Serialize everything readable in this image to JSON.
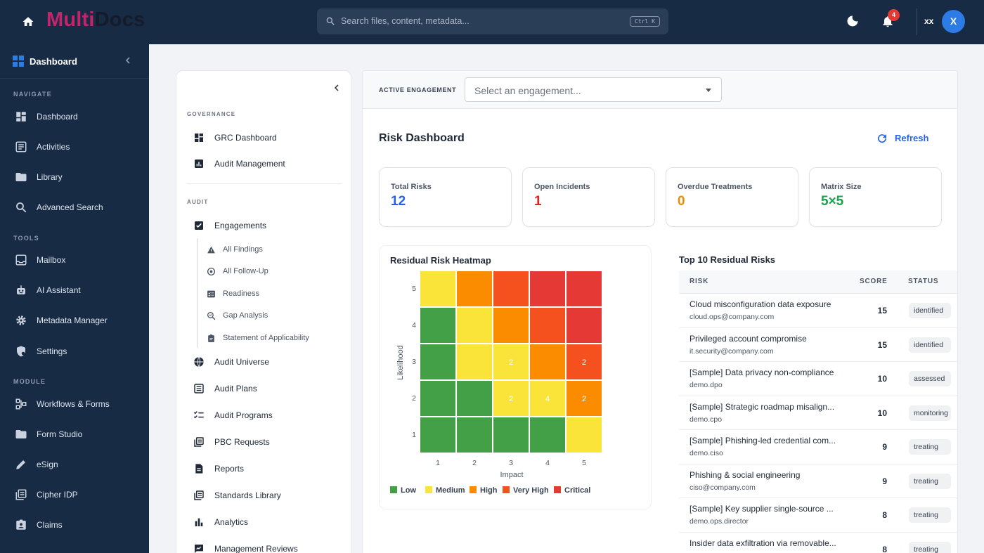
{
  "topbar": {
    "logo_part1": "Multi",
    "logo_part2": "Docs",
    "search_placeholder": "Search files, content, metadata...",
    "search_shortcut": "Ctrl K",
    "notification_count": "4",
    "user_initials": "xx",
    "avatar_letter": "X"
  },
  "sidebar": {
    "title": "Dashboard",
    "sections": {
      "navigate": "NAVIGATE",
      "tools": "TOOLS",
      "module": "MODULE"
    },
    "items": [
      {
        "label": "Dashboard",
        "icon": "dashboard-icon"
      },
      {
        "label": "Activities",
        "icon": "list-icon"
      },
      {
        "label": "Library",
        "icon": "folder-icon"
      },
      {
        "label": "Advanced Search",
        "icon": "search-icon"
      },
      {
        "label": "Mailbox",
        "icon": "inbox-icon"
      },
      {
        "label": "AI Assistant",
        "icon": "robot-icon"
      },
      {
        "label": "Metadata Manager",
        "icon": "gear-icon"
      },
      {
        "label": "Settings",
        "icon": "shield-gear-icon"
      },
      {
        "label": "Workflows & Forms",
        "icon": "workflow-icon"
      },
      {
        "label": "Form Studio",
        "icon": "folder-icon"
      },
      {
        "label": "eSign",
        "icon": "pen-icon"
      },
      {
        "label": "Cipher IDP",
        "icon": "stack-icon"
      },
      {
        "label": "Claims",
        "icon": "person-badge-icon"
      }
    ]
  },
  "panel2": {
    "sections": {
      "governance": "GOVERNANCE",
      "audit": "AUDIT"
    },
    "governance_items": [
      {
        "label": "GRC Dashboard"
      },
      {
        "label": "Audit Management"
      }
    ],
    "engagements": "Engagements",
    "sub_items": [
      {
        "label": "All Findings"
      },
      {
        "label": "All Follow-Up"
      },
      {
        "label": "Readiness"
      },
      {
        "label": "Gap Analysis"
      },
      {
        "label": "Statement of Applicability"
      }
    ],
    "audit_items": [
      {
        "label": "Audit Universe"
      },
      {
        "label": "Audit Plans"
      },
      {
        "label": "Audit Programs"
      },
      {
        "label": "PBC Requests"
      },
      {
        "label": "Reports"
      },
      {
        "label": "Standards Library"
      },
      {
        "label": "Analytics"
      },
      {
        "label": "Management Reviews"
      }
    ]
  },
  "main": {
    "active_engagement_label": "ACTIVE ENGAGEMENT",
    "engagement_placeholder": "Select an engagement...",
    "title": "Risk Dashboard",
    "refresh_label": "Refresh",
    "kpis": [
      {
        "label": "Total Risks",
        "value": "12",
        "color": "#2563eb"
      },
      {
        "label": "Open Incidents",
        "value": "1",
        "color": "#dc2626"
      },
      {
        "label": "Overdue Treatments",
        "value": "0",
        "color": "#f08c00"
      },
      {
        "label": "Matrix Size",
        "value": "5×5",
        "color": "#16a34a"
      }
    ],
    "heatmap": {
      "title": "Residual Risk Heatmap",
      "xlabel": "Impact",
      "ylabel": "Likelihood",
      "x_ticks": [
        "1",
        "2",
        "3",
        "4",
        "5"
      ],
      "y_ticks": [
        "5",
        "4",
        "3",
        "2",
        "1"
      ],
      "rows": [
        [
          {
            "level": "Medium",
            "count": ""
          },
          {
            "level": "High",
            "count": ""
          },
          {
            "level": "Very High",
            "count": ""
          },
          {
            "level": "Critical",
            "count": ""
          },
          {
            "level": "Critical",
            "count": ""
          }
        ],
        [
          {
            "level": "Low",
            "count": ""
          },
          {
            "level": "Medium",
            "count": ""
          },
          {
            "level": "High",
            "count": ""
          },
          {
            "level": "Very High",
            "count": ""
          },
          {
            "level": "Critical",
            "count": ""
          }
        ],
        [
          {
            "level": "Low",
            "count": ""
          },
          {
            "level": "Medium",
            "count": ""
          },
          {
            "level": "Medium",
            "count": "2"
          },
          {
            "level": "High",
            "count": ""
          },
          {
            "level": "Very High",
            "count": "2"
          }
        ],
        [
          {
            "level": "Low",
            "count": ""
          },
          {
            "level": "Low",
            "count": ""
          },
          {
            "level": "Medium",
            "count": "2"
          },
          {
            "level": "Medium",
            "count": "4"
          },
          {
            "level": "High",
            "count": "2"
          }
        ],
        [
          {
            "level": "Low",
            "count": ""
          },
          {
            "level": "Low",
            "count": ""
          },
          {
            "level": "Low",
            "count": ""
          },
          {
            "level": "Low",
            "count": ""
          },
          {
            "level": "Medium",
            "count": ""
          }
        ]
      ],
      "legend": [
        {
          "label": "Low",
          "color": "#43a047"
        },
        {
          "label": "Medium",
          "color": "#fbe43a"
        },
        {
          "label": "High",
          "color": "#fb8c00"
        },
        {
          "label": "Very High",
          "color": "#f4511e"
        },
        {
          "label": "Critical",
          "color": "#e53935"
        }
      ]
    },
    "top_risks": {
      "title": "Top 10 Residual Risks",
      "headers": {
        "risk": "RISK",
        "score": "SCORE",
        "status": "STATUS"
      },
      "rows": [
        {
          "name": "Cloud misconfiguration data exposure",
          "owner": "cloud.ops@company.com",
          "score": "15",
          "status": "identified"
        },
        {
          "name": "Privileged account compromise",
          "owner": "it.security@company.com",
          "score": "15",
          "status": "identified"
        },
        {
          "name": "[Sample] Data privacy non-compliance",
          "owner": "demo.dpo",
          "score": "10",
          "status": "assessed"
        },
        {
          "name": "[Sample] Strategic roadmap misalign...",
          "owner": "demo.cpo",
          "score": "10",
          "status": "monitoring"
        },
        {
          "name": "[Sample] Phishing-led credential com...",
          "owner": "demo.ciso",
          "score": "9",
          "status": "treating"
        },
        {
          "name": "Phishing & social engineering",
          "owner": "ciso@company.com",
          "score": "9",
          "status": "treating"
        },
        {
          "name": "[Sample] Key supplier single-source ...",
          "owner": "demo.ops.director",
          "score": "8",
          "status": "treating"
        },
        {
          "name": "Insider data exfiltration via removable...",
          "owner": "",
          "score": "8",
          "status": "treating"
        }
      ]
    }
  }
}
